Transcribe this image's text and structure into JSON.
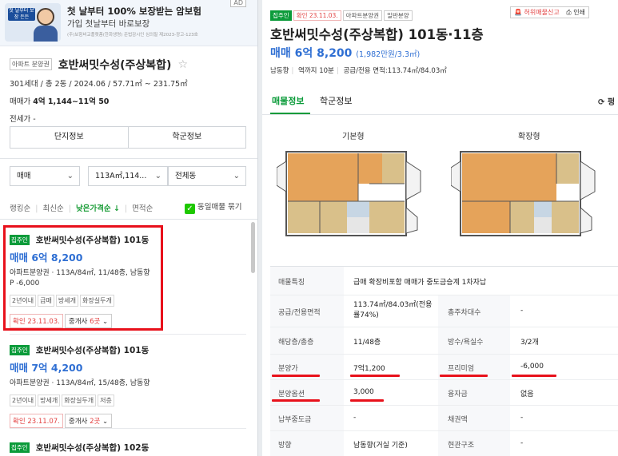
{
  "ad": {
    "image_tag": "첫 날부터 보장 든든",
    "title": "첫 날부터 100% 보장받는 암보험",
    "subtitle": "가입 첫날부터 바로보장",
    "fine": "(주)보험비교플랫폼(한화생명) 준법감시인 심의필 제2023-광고-123호",
    "badge": "AD"
  },
  "complex": {
    "type_tag": "아파트 분양권",
    "name": "호반써밋수성(주상복합)",
    "info": "301세대 / 총 2동 / 2024.06 / 57.71㎡ ~ 231.75㎡",
    "sale_label": "매매가",
    "sale_value": "4억 1,144~11억 50",
    "rent_label": "전세가",
    "rent_value": "-"
  },
  "complex_tabs": [
    "단지정보",
    "학군정보"
  ],
  "filters": {
    "trade": "매매",
    "area": "113A㎡,114...",
    "building": "전체동"
  },
  "sorts": {
    "items": [
      "랭킹순",
      "최신순",
      "낮은가격순 ↓",
      "면적순"
    ],
    "active_index": 2,
    "dup_label": "동일매물 묶기"
  },
  "listings": [
    {
      "tag": "집주인",
      "name": "호반써밋수성(주상복합) 101동",
      "price": "매매 6억 8,200",
      "desc": "아파트분양권 · 113A/84㎡, 11/48층, 남동향",
      "premium": "P -6,000",
      "tags": [
        "2년이내",
        "급매",
        "방세개",
        "화장실두개"
      ],
      "confirm": "확인 23.11.03.",
      "agent_label": "중개사",
      "agent_count": "6곳"
    },
    {
      "tag": "집주인",
      "name": "호반써밋수성(주상복합) 101동",
      "price": "매매 7억 4,200",
      "desc": "아파트분양권 · 113A/84㎡, 15/48층, 남동향",
      "premium": "",
      "tags": [
        "2년이내",
        "방세개",
        "화장실두개",
        "저층"
      ],
      "confirm": "확인 23.11.07.",
      "agent_label": "중개사",
      "agent_count": "2곳"
    },
    {
      "tag": "집주인",
      "name": "호반써밋수성(주상복합) 102동"
    }
  ],
  "detail": {
    "tag_owner": "집주인",
    "tag_confirm": "확인 23.11.03.",
    "tag_type": "아파트분양권",
    "tag_general": "일반분양",
    "report_label": "허위매물신고",
    "print_label": "인쇄",
    "title": "호반써밋수성(주상복합) 101동·11층",
    "price": "매매 6억 8,200",
    "price_sub": "(1,982만원/3.3㎡)",
    "meta": [
      "남동향",
      "역까지 10분",
      "공급/전용 면적:113.74㎡/84.03㎡"
    ],
    "tabs": [
      "매물정보",
      "학군정보"
    ],
    "refresh_label": "⟳ 펑",
    "plan_labels": [
      "기본형",
      "확장형"
    ]
  },
  "table": [
    {
      "k": "매물특징",
      "v": "급매 확장비포함 매매가 중도금승계 1차자납",
      "k2": "",
      "v2": ""
    },
    {
      "k": "공급/전용면적",
      "v": "113.74㎡/84.03㎡(전용률74%)",
      "k2": "총주차대수",
      "v2": "-"
    },
    {
      "k": "해당층/총층",
      "v": "11/48층",
      "k2": "방수/욕실수",
      "v2": "3/2개"
    },
    {
      "k": "분양가",
      "v": "7억1,200",
      "k2": "프리미엄",
      "v2": "-6,000"
    },
    {
      "k": "분양옵션",
      "v": "3,000",
      "k2": "융자금",
      "v2": "없음"
    },
    {
      "k": "납부중도금",
      "v": "-",
      "k2": "채권액",
      "v2": "-"
    },
    {
      "k": "방향",
      "v": "남동향(거실 기준)",
      "k2": "현관구조",
      "v2": "-"
    }
  ],
  "colors": {
    "brand_green": "#0b9b3a",
    "price_blue": "#2f6fd3",
    "alert_red": "#e34444",
    "annotation_red": "#e8111b"
  }
}
